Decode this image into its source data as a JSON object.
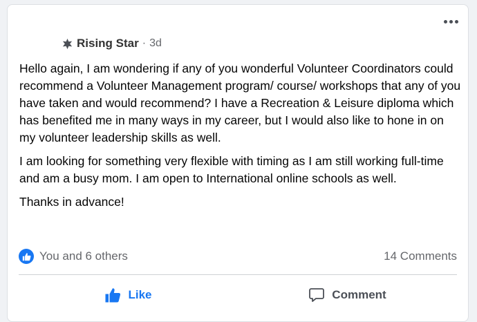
{
  "post": {
    "badge_icon": "rising-star-icon",
    "badge": "Rising Star",
    "separator": "·",
    "time": "3d",
    "paragraphs": [
      "Hello again, I am wondering if any of you wonderful Volunteer Coordinators could recommend a Volunteer Management program/ course/ workshops that any of you have taken and would recommend? I have a Recreation & Leisure diploma which has benefited me in many ways in my career, but I would also like to hone in on my volunteer leadership skills as well.",
      "I am looking for something very flexible with timing as I am still working full-time and am a busy mom. I am open to International online schools as well.",
      "Thanks in advance!"
    ]
  },
  "stats": {
    "reactions_icon": "like-reaction-icon",
    "reactions": "You and 6 others",
    "comments": "14 Comments"
  },
  "actions": {
    "like_label": "Like",
    "like_icon": "thumbs-up-icon",
    "comment_label": "Comment",
    "comment_icon": "speech-bubble-icon"
  },
  "colors": {
    "accent": "#1877f2",
    "muted": "#65676b"
  }
}
